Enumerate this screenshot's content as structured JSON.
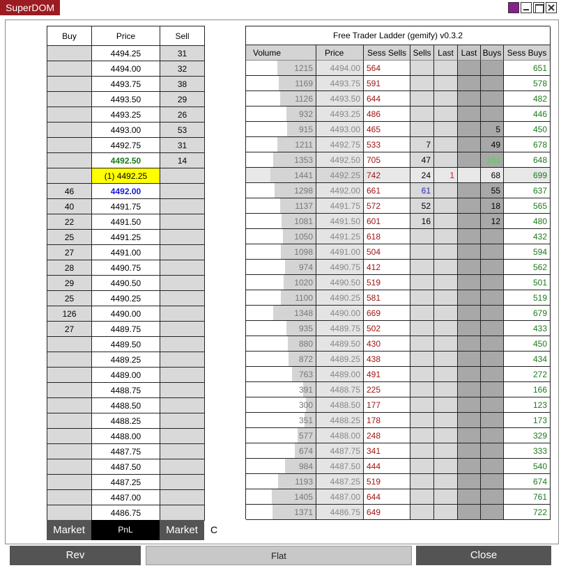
{
  "window": {
    "title": "SuperDOM"
  },
  "dom": {
    "headers": [
      "Buy",
      "Price",
      "Sell"
    ],
    "rows": [
      {
        "buy": "",
        "price": "4494.25",
        "sell": "31"
      },
      {
        "buy": "",
        "price": "4494.00",
        "sell": "32"
      },
      {
        "buy": "",
        "price": "4493.75",
        "sell": "38"
      },
      {
        "buy": "",
        "price": "4493.50",
        "sell": "29"
      },
      {
        "buy": "",
        "price": "4493.25",
        "sell": "26"
      },
      {
        "buy": "",
        "price": "4493.00",
        "sell": "53"
      },
      {
        "buy": "",
        "price": "4492.75",
        "sell": "31"
      },
      {
        "buy": "",
        "price": "4492.50",
        "sell": "14",
        "style": "ask"
      },
      {
        "buy": "",
        "price": "(1) 4492.25",
        "sell": "",
        "style": "last"
      },
      {
        "buy": "46",
        "price": "4492.00",
        "sell": "",
        "style": "bid"
      },
      {
        "buy": "40",
        "price": "4491.75",
        "sell": ""
      },
      {
        "buy": "22",
        "price": "4491.50",
        "sell": ""
      },
      {
        "buy": "25",
        "price": "4491.25",
        "sell": ""
      },
      {
        "buy": "27",
        "price": "4491.00",
        "sell": ""
      },
      {
        "buy": "28",
        "price": "4490.75",
        "sell": ""
      },
      {
        "buy": "29",
        "price": "4490.50",
        "sell": ""
      },
      {
        "buy": "25",
        "price": "4490.25",
        "sell": ""
      },
      {
        "buy": "126",
        "price": "4490.00",
        "sell": ""
      },
      {
        "buy": "27",
        "price": "4489.75",
        "sell": ""
      },
      {
        "buy": "",
        "price": "4489.50",
        "sell": ""
      },
      {
        "buy": "",
        "price": "4489.25",
        "sell": ""
      },
      {
        "buy": "",
        "price": "4489.00",
        "sell": ""
      },
      {
        "buy": "",
        "price": "4488.75",
        "sell": ""
      },
      {
        "buy": "",
        "price": "4488.50",
        "sell": ""
      },
      {
        "buy": "",
        "price": "4488.25",
        "sell": ""
      },
      {
        "buy": "",
        "price": "4488.00",
        "sell": ""
      },
      {
        "buy": "",
        "price": "4487.75",
        "sell": ""
      },
      {
        "buy": "",
        "price": "4487.50",
        "sell": ""
      },
      {
        "buy": "",
        "price": "4487.25",
        "sell": ""
      },
      {
        "buy": "",
        "price": "4487.00",
        "sell": ""
      },
      {
        "buy": "",
        "price": "4486.75",
        "sell": ""
      }
    ],
    "market_buy_label": "Market",
    "pnl_label": "PnL",
    "market_sell_label": "Market",
    "c_label": "C"
  },
  "ladder": {
    "title": "Free Trader Ladder (gemify) v0.3.2",
    "headers": [
      "Volume",
      "Price",
      "Sess Sells",
      "Sells",
      "Last",
      "Last",
      "Buys",
      "Sess Buys"
    ],
    "volume_max": 1441,
    "rows": [
      {
        "volume": "1215",
        "price": "4494.00",
        "sess_sells": "564",
        "sells": "",
        "last_s": "",
        "last_b": "",
        "buys": "",
        "sess_buys": "651"
      },
      {
        "volume": "1169",
        "price": "4493.75",
        "sess_sells": "591",
        "sells": "",
        "last_s": "",
        "last_b": "",
        "buys": "",
        "sess_buys": "578"
      },
      {
        "volume": "1126",
        "price": "4493.50",
        "sess_sells": "644",
        "sells": "",
        "last_s": "",
        "last_b": "",
        "buys": "",
        "sess_buys": "482"
      },
      {
        "volume": "932",
        "price": "4493.25",
        "sess_sells": "486",
        "sells": "",
        "last_s": "",
        "last_b": "",
        "buys": "",
        "sess_buys": "446"
      },
      {
        "volume": "915",
        "price": "4493.00",
        "sess_sells": "465",
        "sells": "",
        "last_s": "",
        "last_b": "",
        "buys": "5",
        "sess_buys": "450"
      },
      {
        "volume": "1211",
        "price": "4492.75",
        "sess_sells": "533",
        "sells": "7",
        "last_s": "",
        "last_b": "",
        "buys": "49",
        "sess_buys": "678"
      },
      {
        "volume": "1353",
        "price": "4492.50",
        "sess_sells": "705",
        "sells": "47",
        "last_s": "",
        "last_b": "",
        "buys": "101",
        "sess_buys": "648",
        "buys_color": "#3fdc3f"
      },
      {
        "volume": "1441",
        "price": "4492.25",
        "sess_sells": "742",
        "sells": "24",
        "last_s": "1",
        "last_b": "",
        "buys": "68",
        "sess_buys": "699",
        "current": true
      },
      {
        "volume": "1298",
        "price": "4492.00",
        "sess_sells": "661",
        "sells": "61",
        "last_s": "",
        "last_b": "",
        "buys": "55",
        "sess_buys": "637",
        "sells_color": "#2a2aa8"
      },
      {
        "volume": "1137",
        "price": "4491.75",
        "sess_sells": "572",
        "sells": "52",
        "last_s": "",
        "last_b": "",
        "buys": "18",
        "sess_buys": "565"
      },
      {
        "volume": "1081",
        "price": "4491.50",
        "sess_sells": "601",
        "sells": "16",
        "last_s": "",
        "last_b": "",
        "buys": "12",
        "sess_buys": "480"
      },
      {
        "volume": "1050",
        "price": "4491.25",
        "sess_sells": "618",
        "sells": "",
        "last_s": "",
        "last_b": "",
        "buys": "",
        "sess_buys": "432"
      },
      {
        "volume": "1098",
        "price": "4491.00",
        "sess_sells": "504",
        "sells": "",
        "last_s": "",
        "last_b": "",
        "buys": "",
        "sess_buys": "594"
      },
      {
        "volume": "974",
        "price": "4490.75",
        "sess_sells": "412",
        "sells": "",
        "last_s": "",
        "last_b": "",
        "buys": "",
        "sess_buys": "562"
      },
      {
        "volume": "1020",
        "price": "4490.50",
        "sess_sells": "519",
        "sells": "",
        "last_s": "",
        "last_b": "",
        "buys": "",
        "sess_buys": "501"
      },
      {
        "volume": "1100",
        "price": "4490.25",
        "sess_sells": "581",
        "sells": "",
        "last_s": "",
        "last_b": "",
        "buys": "",
        "sess_buys": "519"
      },
      {
        "volume": "1348",
        "price": "4490.00",
        "sess_sells": "669",
        "sells": "",
        "last_s": "",
        "last_b": "",
        "buys": "",
        "sess_buys": "679"
      },
      {
        "volume": "935",
        "price": "4489.75",
        "sess_sells": "502",
        "sells": "",
        "last_s": "",
        "last_b": "",
        "buys": "",
        "sess_buys": "433"
      },
      {
        "volume": "880",
        "price": "4489.50",
        "sess_sells": "430",
        "sells": "",
        "last_s": "",
        "last_b": "",
        "buys": "",
        "sess_buys": "450"
      },
      {
        "volume": "872",
        "price": "4489.25",
        "sess_sells": "438",
        "sells": "",
        "last_s": "",
        "last_b": "",
        "buys": "",
        "sess_buys": "434"
      },
      {
        "volume": "763",
        "price": "4489.00",
        "sess_sells": "491",
        "sells": "",
        "last_s": "",
        "last_b": "",
        "buys": "",
        "sess_buys": "272"
      },
      {
        "volume": "391",
        "price": "4488.75",
        "sess_sells": "225",
        "sells": "",
        "last_s": "",
        "last_b": "",
        "buys": "",
        "sess_buys": "166"
      },
      {
        "volume": "300",
        "price": "4488.50",
        "sess_sells": "177",
        "sells": "",
        "last_s": "",
        "last_b": "",
        "buys": "",
        "sess_buys": "123"
      },
      {
        "volume": "351",
        "price": "4488.25",
        "sess_sells": "178",
        "sells": "",
        "last_s": "",
        "last_b": "",
        "buys": "",
        "sess_buys": "173"
      },
      {
        "volume": "577",
        "price": "4488.00",
        "sess_sells": "248",
        "sells": "",
        "last_s": "",
        "last_b": "",
        "buys": "",
        "sess_buys": "329"
      },
      {
        "volume": "674",
        "price": "4487.75",
        "sess_sells": "341",
        "sells": "",
        "last_s": "",
        "last_b": "",
        "buys": "",
        "sess_buys": "333"
      },
      {
        "volume": "984",
        "price": "4487.50",
        "sess_sells": "444",
        "sells": "",
        "last_s": "",
        "last_b": "",
        "buys": "",
        "sess_buys": "540"
      },
      {
        "volume": "1193",
        "price": "4487.25",
        "sess_sells": "519",
        "sells": "",
        "last_s": "",
        "last_b": "",
        "buys": "",
        "sess_buys": "674"
      },
      {
        "volume": "1405",
        "price": "4487.00",
        "sess_sells": "644",
        "sells": "",
        "last_s": "",
        "last_b": "",
        "buys": "",
        "sess_buys": "761"
      },
      {
        "volume": "1371",
        "price": "4486.75",
        "sess_sells": "649",
        "sells": "",
        "last_s": "",
        "last_b": "",
        "buys": "",
        "sess_buys": "722"
      }
    ]
  },
  "buttons": {
    "rev": "Rev",
    "flat": "Flat",
    "close": "Close"
  },
  "colors": {
    "ask_price": "#1a7a1a",
    "bid_price": "#1a1ad6",
    "last_bg": "#ffff00",
    "sess_sells": "#a01414",
    "sess_buys": "#1a7a1a",
    "last_sell": "#d01414",
    "cell_gray": "#d9d9d9",
    "dark_gray": "#a8a8a8",
    "vol_bar": "#d4d4d4"
  }
}
